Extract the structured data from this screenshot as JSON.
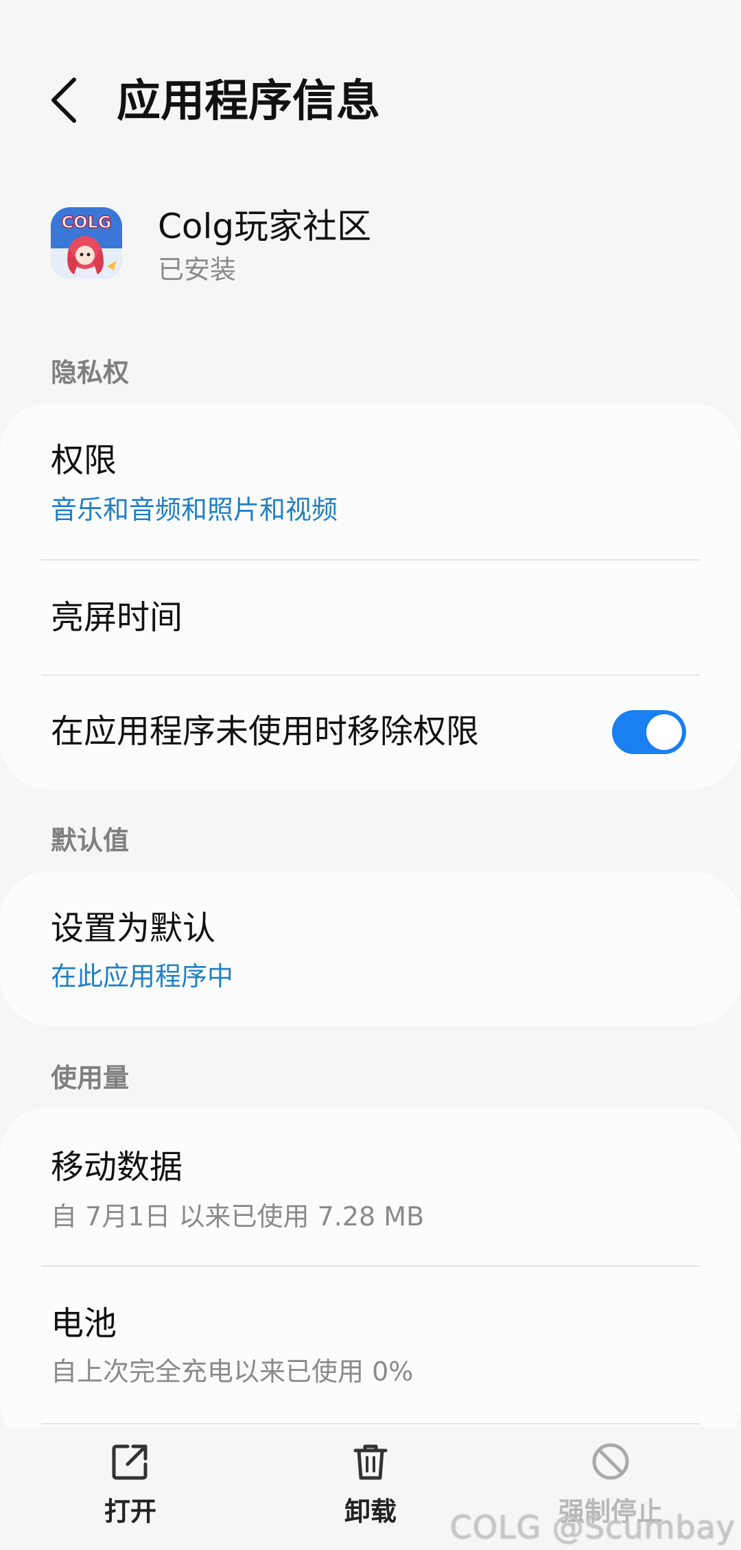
{
  "header": {
    "title": "应用程序信息"
  },
  "app": {
    "name": "Colg玩家社区",
    "status": "已安装",
    "icon_text": "COLG"
  },
  "privacy": {
    "section_label": "隐私权",
    "permissions": {
      "title": "权限",
      "subtitle": "音乐和音频和照片和视频"
    },
    "screen_time": {
      "title": "亮屏时间"
    },
    "remove_permissions": {
      "title": "在应用程序未使用时移除权限",
      "enabled": true
    }
  },
  "defaults": {
    "section_label": "默认值",
    "set_default": {
      "title": "设置为默认",
      "subtitle": "在此应用程序中"
    }
  },
  "usage": {
    "section_label": "使用量",
    "mobile_data": {
      "title": "移动数据",
      "subtitle": "自 7月1日 以来已使用 7.28 MB"
    },
    "battery": {
      "title": "电池",
      "subtitle": "自上次完全充电以来已使用 0%"
    }
  },
  "bottom_bar": {
    "open_label": "打开",
    "uninstall_label": "卸载",
    "force_stop_label": "强制停止"
  },
  "watermark": "COLG @Scumbay",
  "colors": {
    "accent": "#1a7ff0",
    "link": "#1f7fc6",
    "background": "#f6f6f6",
    "card": "#fcfcfc"
  }
}
